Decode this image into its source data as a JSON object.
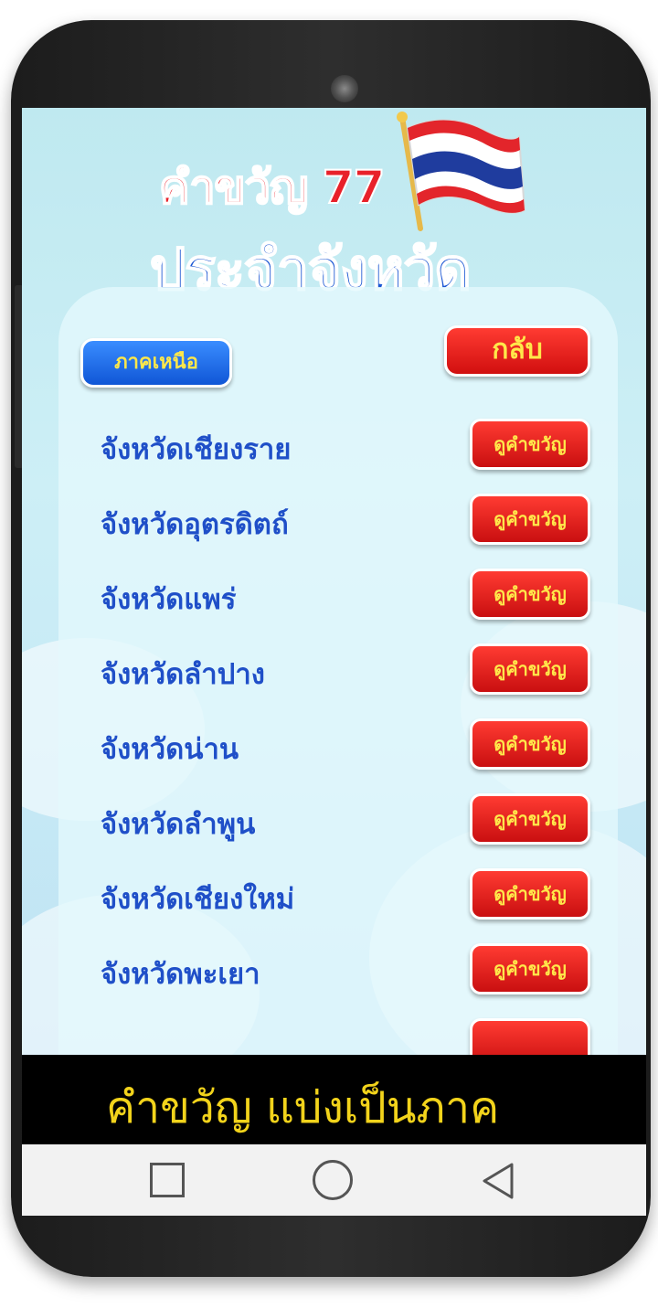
{
  "app": {
    "logo_line1": "คำขวัญ 77",
    "logo_line2": "ประจำจังหวัด"
  },
  "header": {
    "region_label": "ภาคเหนือ",
    "back_label": "กลับ"
  },
  "provinces": [
    {
      "name": "จังหวัดเชียงราย",
      "button": "ดูคำขวัญ"
    },
    {
      "name": "จังหวัดอุตรดิตถ์",
      "button": "ดูคำขวัญ"
    },
    {
      "name": "จังหวัดแพร่",
      "button": "ดูคำขวัญ"
    },
    {
      "name": "จังหวัดลำปาง",
      "button": "ดูคำขวัญ"
    },
    {
      "name": "จังหวัดน่าน",
      "button": "ดูคำขวัญ"
    },
    {
      "name": "จังหวัดลำพูน",
      "button": "ดูคำขวัญ"
    },
    {
      "name": "จังหวัดเชียงใหม่",
      "button": "ดูคำขวัญ"
    },
    {
      "name": "จังหวัดพะเยา",
      "button": "ดูคำขวัญ"
    }
  ],
  "caption": "คำขวัญ  แบ่งเป็นภาค",
  "nav": {
    "icons": [
      "recents-square-icon",
      "home-circle-icon",
      "back-triangle-icon"
    ]
  },
  "colors": {
    "accent_red": "#e8212a",
    "accent_blue": "#1b57d3",
    "label_yellow": "#ffe84a",
    "caption_yellow": "#f2d31b"
  }
}
